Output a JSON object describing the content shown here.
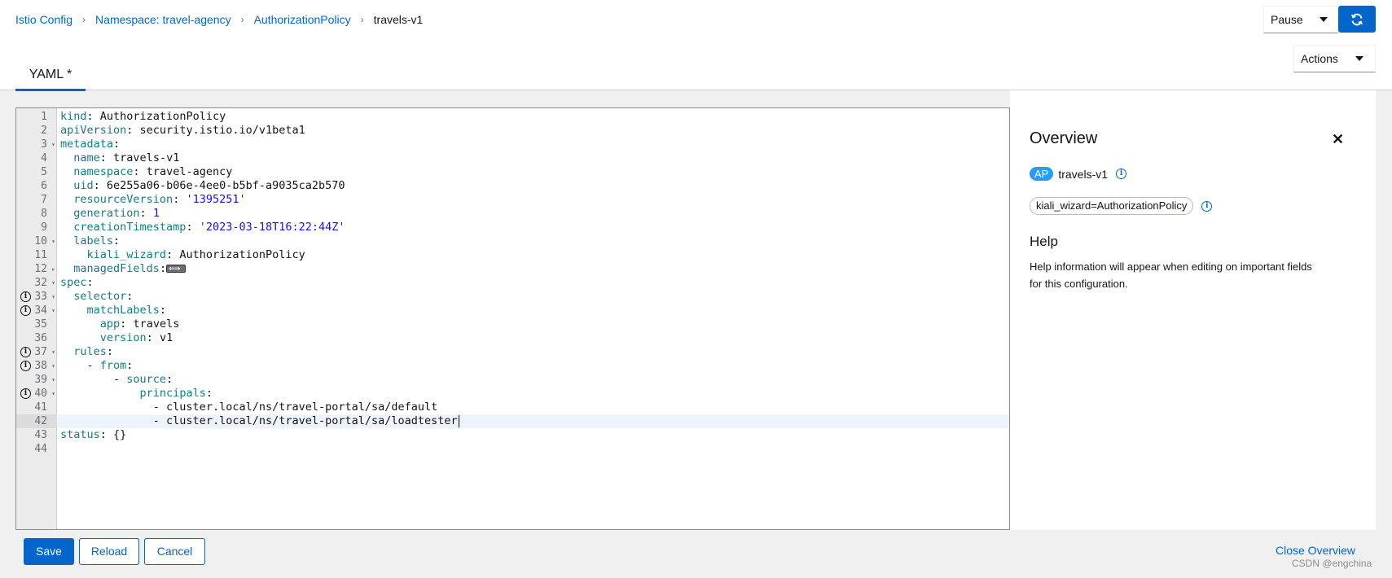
{
  "breadcrumb": {
    "items": [
      "Istio Config",
      "Namespace: travel-agency",
      "AuthorizationPolicy"
    ],
    "current": "travels-v1",
    "separator": "›"
  },
  "toolbar": {
    "pause_label": "Pause",
    "refresh_icon": "sync-icon",
    "actions_label": "Actions"
  },
  "tabs": [
    {
      "label": "YAML *",
      "active": true
    }
  ],
  "editor": {
    "lines": [
      {
        "num": "1",
        "fold": "",
        "info": false,
        "html": "<span class=\"k\">kind</span>: <span class=\"n\">AuthorizationPolicy</span>"
      },
      {
        "num": "2",
        "fold": "",
        "info": false,
        "html": "<span class=\"k\">apiVersion</span>: <span class=\"n\">security.istio.io/v1beta1</span>"
      },
      {
        "num": "3",
        "fold": "▾",
        "info": false,
        "html": "<span class=\"k\">metadata</span>:"
      },
      {
        "num": "4",
        "fold": "",
        "info": false,
        "html": "  <span class=\"k\">name</span>: <span class=\"n\">travels-v1</span>"
      },
      {
        "num": "5",
        "fold": "",
        "info": false,
        "html": "  <span class=\"k\">namespace</span>: <span class=\"n\">travel-agency</span>"
      },
      {
        "num": "6",
        "fold": "",
        "info": false,
        "html": "  <span class=\"k\">uid</span>: <span class=\"n\">6e255a06-b06e-4ee0-b5bf-a9035ca2b570</span>"
      },
      {
        "num": "7",
        "fold": "",
        "info": false,
        "html": "  <span class=\"k\">resourceVersion</span>: <span class=\"s\">'1395251'</span>"
      },
      {
        "num": "8",
        "fold": "",
        "info": false,
        "html": "  <span class=\"k\">generation</span>: <span class=\"s\">1</span>"
      },
      {
        "num": "9",
        "fold": "",
        "info": false,
        "html": "  <span class=\"k\">creationTimestamp</span>: <span class=\"s\">'2023-03-18T16:22:44Z'</span>"
      },
      {
        "num": "10",
        "fold": "▾",
        "info": false,
        "html": "  <span class=\"k\">labels</span>:"
      },
      {
        "num": "11",
        "fold": "",
        "info": false,
        "html": "    <span class=\"k\">kiali_wizard</span>: <span class=\"n\">AuthorizationPolicy</span>"
      },
      {
        "num": "12",
        "fold": "▸",
        "info": false,
        "html": "  <span class=\"k\">managedFields</span>:<span class=\"collapsed\"></span>"
      },
      {
        "num": "32",
        "fold": "▾",
        "info": false,
        "html": "<span class=\"k\">spec</span>:"
      },
      {
        "num": "33",
        "fold": "▾",
        "info": true,
        "html": "  <span class=\"k\">selector</span>:"
      },
      {
        "num": "34",
        "fold": "▾",
        "info": true,
        "html": "    <span class=\"k\">matchLabels</span>:"
      },
      {
        "num": "35",
        "fold": "",
        "info": false,
        "html": "      <span class=\"k\">app</span>: <span class=\"n\">travels</span>"
      },
      {
        "num": "36",
        "fold": "",
        "info": false,
        "html": "      <span class=\"k\">version</span>: <span class=\"n\">v1</span>"
      },
      {
        "num": "37",
        "fold": "▾",
        "info": true,
        "html": "  <span class=\"k\">rules</span>:"
      },
      {
        "num": "38",
        "fold": "▾",
        "info": true,
        "html": "    - <span class=\"k\">from</span>:"
      },
      {
        "num": "39",
        "fold": "▾",
        "info": false,
        "html": "        - <span class=\"k\">source</span>:"
      },
      {
        "num": "40",
        "fold": "▾",
        "info": true,
        "html": "            <span class=\"k\">principals</span>:"
      },
      {
        "num": "41",
        "fold": "",
        "info": false,
        "html": "              - <span class=\"n\">cluster.local/ns/travel-portal/sa/default</span>"
      },
      {
        "num": "42",
        "fold": "",
        "info": false,
        "active": true,
        "html": "              - <span class=\"n\">cluster.local/ns/travel-portal/sa/loadtester</span><span class=\"cursor\"></span>"
      },
      {
        "num": "43",
        "fold": "",
        "info": false,
        "html": "<span class=\"k\">status</span>: <span class=\"n\">{}</span>"
      },
      {
        "num": "44",
        "fold": "",
        "info": false,
        "html": ""
      }
    ]
  },
  "overview": {
    "title": "Overview",
    "badge": "AP",
    "name": "travels-v1",
    "label_chip": "kiali_wizard=AuthorizationPolicy",
    "help_title": "Help",
    "help_text": "Help information will appear when editing on important fields for this configuration."
  },
  "footer": {
    "save_label": "Save",
    "reload_label": "Reload",
    "cancel_label": "Cancel",
    "close_overview_label": "Close Overview"
  },
  "watermark": "CSDN @engchina"
}
